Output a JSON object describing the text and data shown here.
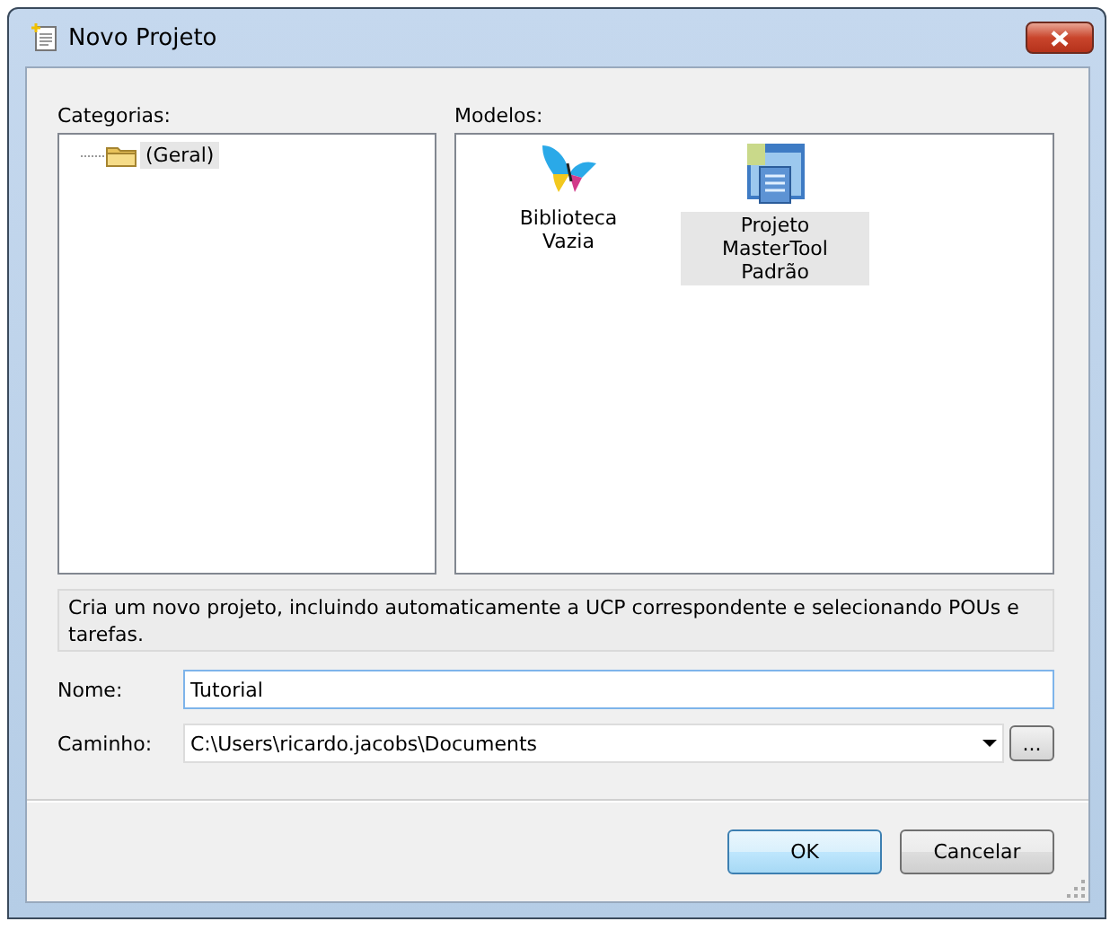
{
  "window": {
    "title": "Novo Projeto"
  },
  "categories": {
    "label": "Categorias:",
    "items": [
      {
        "label": "(Geral)",
        "selected": true
      }
    ]
  },
  "templates": {
    "label": "Modelos:",
    "items": [
      {
        "label": "Biblioteca Vazia",
        "kind": "library",
        "selected": false
      },
      {
        "label": "Projeto MasterTool Padrão",
        "kind": "project",
        "selected": true
      }
    ]
  },
  "description": "Cria um novo projeto, incluindo automaticamente a UCP correspondente e selecionando POUs e tarefas.",
  "name_field": {
    "label": "Nome:",
    "value": "Tutorial"
  },
  "path_field": {
    "label": "Caminho:",
    "value": "C:\\Users\\ricardo.jacobs\\Documents"
  },
  "browse_button": "...",
  "buttons": [
    {
      "label": "OK",
      "default": true
    },
    {
      "label": "Cancelar",
      "default": false
    }
  ]
}
